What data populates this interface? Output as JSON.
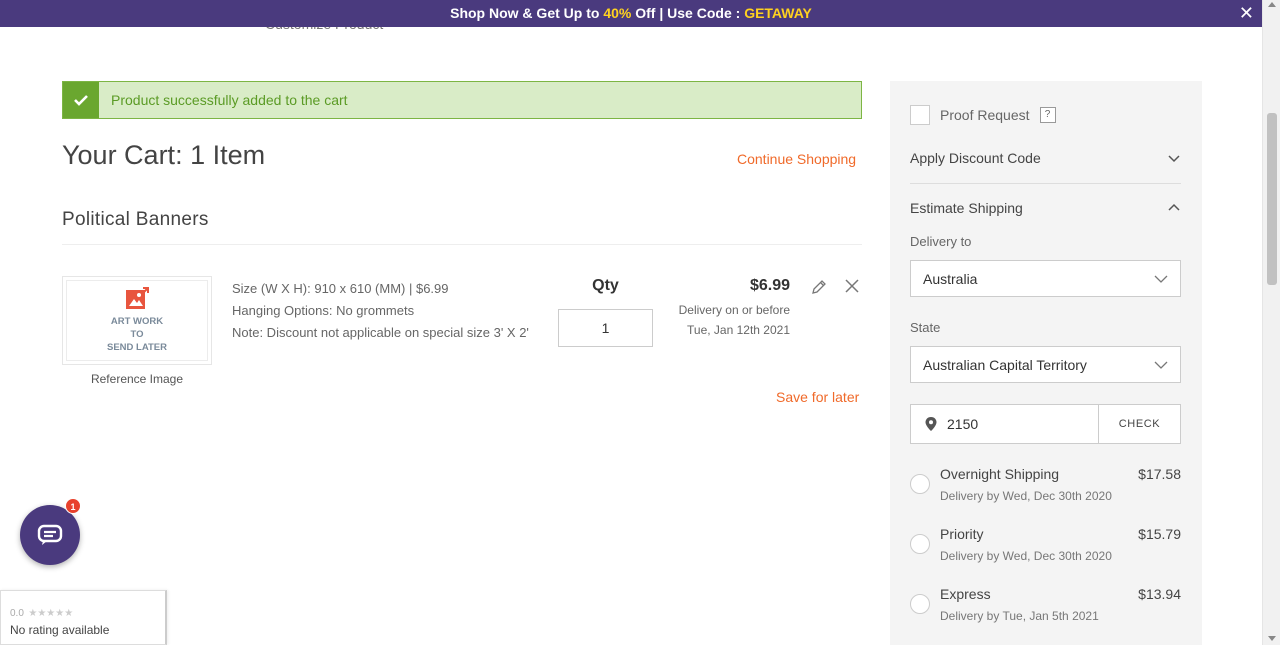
{
  "promo": {
    "text_before": "Shop Now & Get Up to",
    "percent": "40%",
    "text_middle": "Off | Use Code :",
    "code": "GETAWAY",
    "close_symbol": "✕"
  },
  "under_promo_text": "Customize Product",
  "alert": {
    "message": "Product successfully added to the cart"
  },
  "cart": {
    "title": "Your Cart: 1 Item",
    "continue_label": "Continue Shopping",
    "category": "Political Banners",
    "item": {
      "thumb_line1": "ART WORK",
      "thumb_line2": "TO",
      "thumb_line3": "SEND LATER",
      "reference_label": "Reference Image",
      "spec_size": "Size (W X H): 910 x 610 (MM) | $6.99",
      "spec_hanging": "Hanging Options: No grommets",
      "spec_note": "Note: Discount not applicable on special size 3' X 2'",
      "qty_label": "Qty",
      "qty_value": "1",
      "price": "$6.99",
      "delivery_line1": "Delivery on or before",
      "delivery_line2": "Tue, Jan 12th 2021",
      "save_later_label": "Save for later"
    }
  },
  "sidebar": {
    "proof_label": "Proof Request",
    "help_label": "?",
    "discount_label": "Apply Discount Code",
    "estimate_label": "Estimate Shipping",
    "delivery_to_label": "Delivery to",
    "country": "Australia",
    "state_label": "State",
    "state": "Australian Capital Territory",
    "zip": "2150",
    "check_label": "CHECK",
    "shipping_options": [
      {
        "name": "Overnight Shipping",
        "price": "$17.58",
        "date": "Delivery by Wed, Dec 30th 2020"
      },
      {
        "name": "Priority",
        "price": "$15.79",
        "date": "Delivery by Wed, Dec 30th 2020"
      },
      {
        "name": "Express",
        "price": "$13.94",
        "date": "Delivery by Tue, Jan 5th 2021"
      }
    ]
  },
  "chat": {
    "badge_count": "1"
  },
  "rating": {
    "score": "0.0",
    "stars": "★★★★★",
    "text": "No rating available"
  },
  "colors": {
    "brand_purple": "#4a3a7e",
    "promo_highlight": "#ffd21f",
    "accent_orange": "#f06a2a",
    "success_green": "#6aa72f"
  }
}
